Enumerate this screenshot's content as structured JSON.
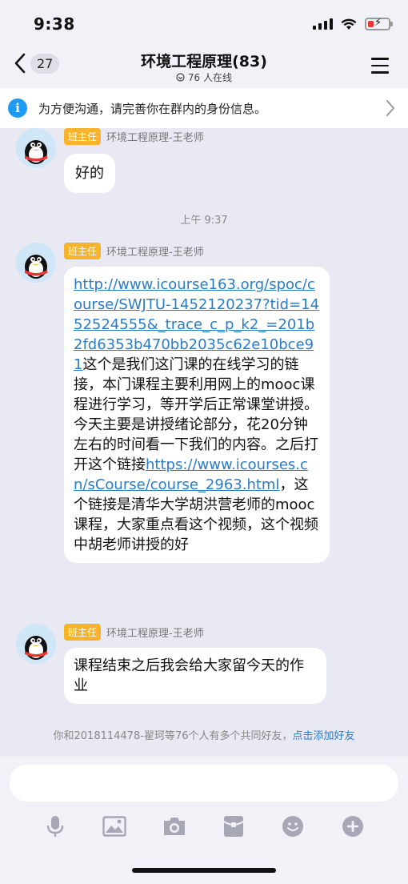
{
  "status_bar": {
    "time": "9:38"
  },
  "header": {
    "back_count": "27",
    "title": "环境工程原理(83)",
    "online": "76 人在线"
  },
  "notice": {
    "text": "为方便沟通，请完善你在群内的身份信息。"
  },
  "messages": [
    {
      "badge": "班主任",
      "sender": "环境工程原理-王老师",
      "text": "好的"
    },
    {
      "badge": "班主任",
      "sender": "环境工程原理-王老师",
      "parts": {
        "link1": "http://www.icourse163.org/spoc/course/SWJTU-1452120237?tid=1452524555&_trace_c_p_k2_=201b2fd6353b470bb2035c62e10bce91",
        "text1": "这个是我们这门课的在线学习的链接，本门课程主要利用网上的mooc课程进行学习，等开学后正常课堂讲授。今天主要是讲授绪论部分，花20分钟左右的时间看一下我们的内容。之后打开这个链接",
        "link2": "https://www.icourses.cn/sCourse/course_2963.html",
        "text2": "，这个链接是清华大学胡洪营老师的mooc课程，大家重点看这个视频，这个视频中胡老师讲授的好"
      }
    },
    {
      "badge": "班主任",
      "sender": "环境工程原理-王老师",
      "text": "课程结束之后我会给大家留今天的作业"
    }
  ],
  "timestamp": "上午 9:37",
  "friends_note": {
    "text": "你和2018114478-翟珂等76个人有多个共同好友，",
    "link": "点击添加好友"
  },
  "icons": {
    "back": "chevron-left-icon",
    "menu": "menu-icon",
    "info": "info-icon",
    "tools": [
      "microphone-icon",
      "image-icon",
      "camera-icon",
      "red-packet-icon",
      "emoji-icon",
      "plus-icon"
    ]
  },
  "colors": {
    "accent": "#2a7cc7",
    "badge": "#f7b32b",
    "info": "#1e9bf0",
    "background": "#e9e9f3"
  }
}
